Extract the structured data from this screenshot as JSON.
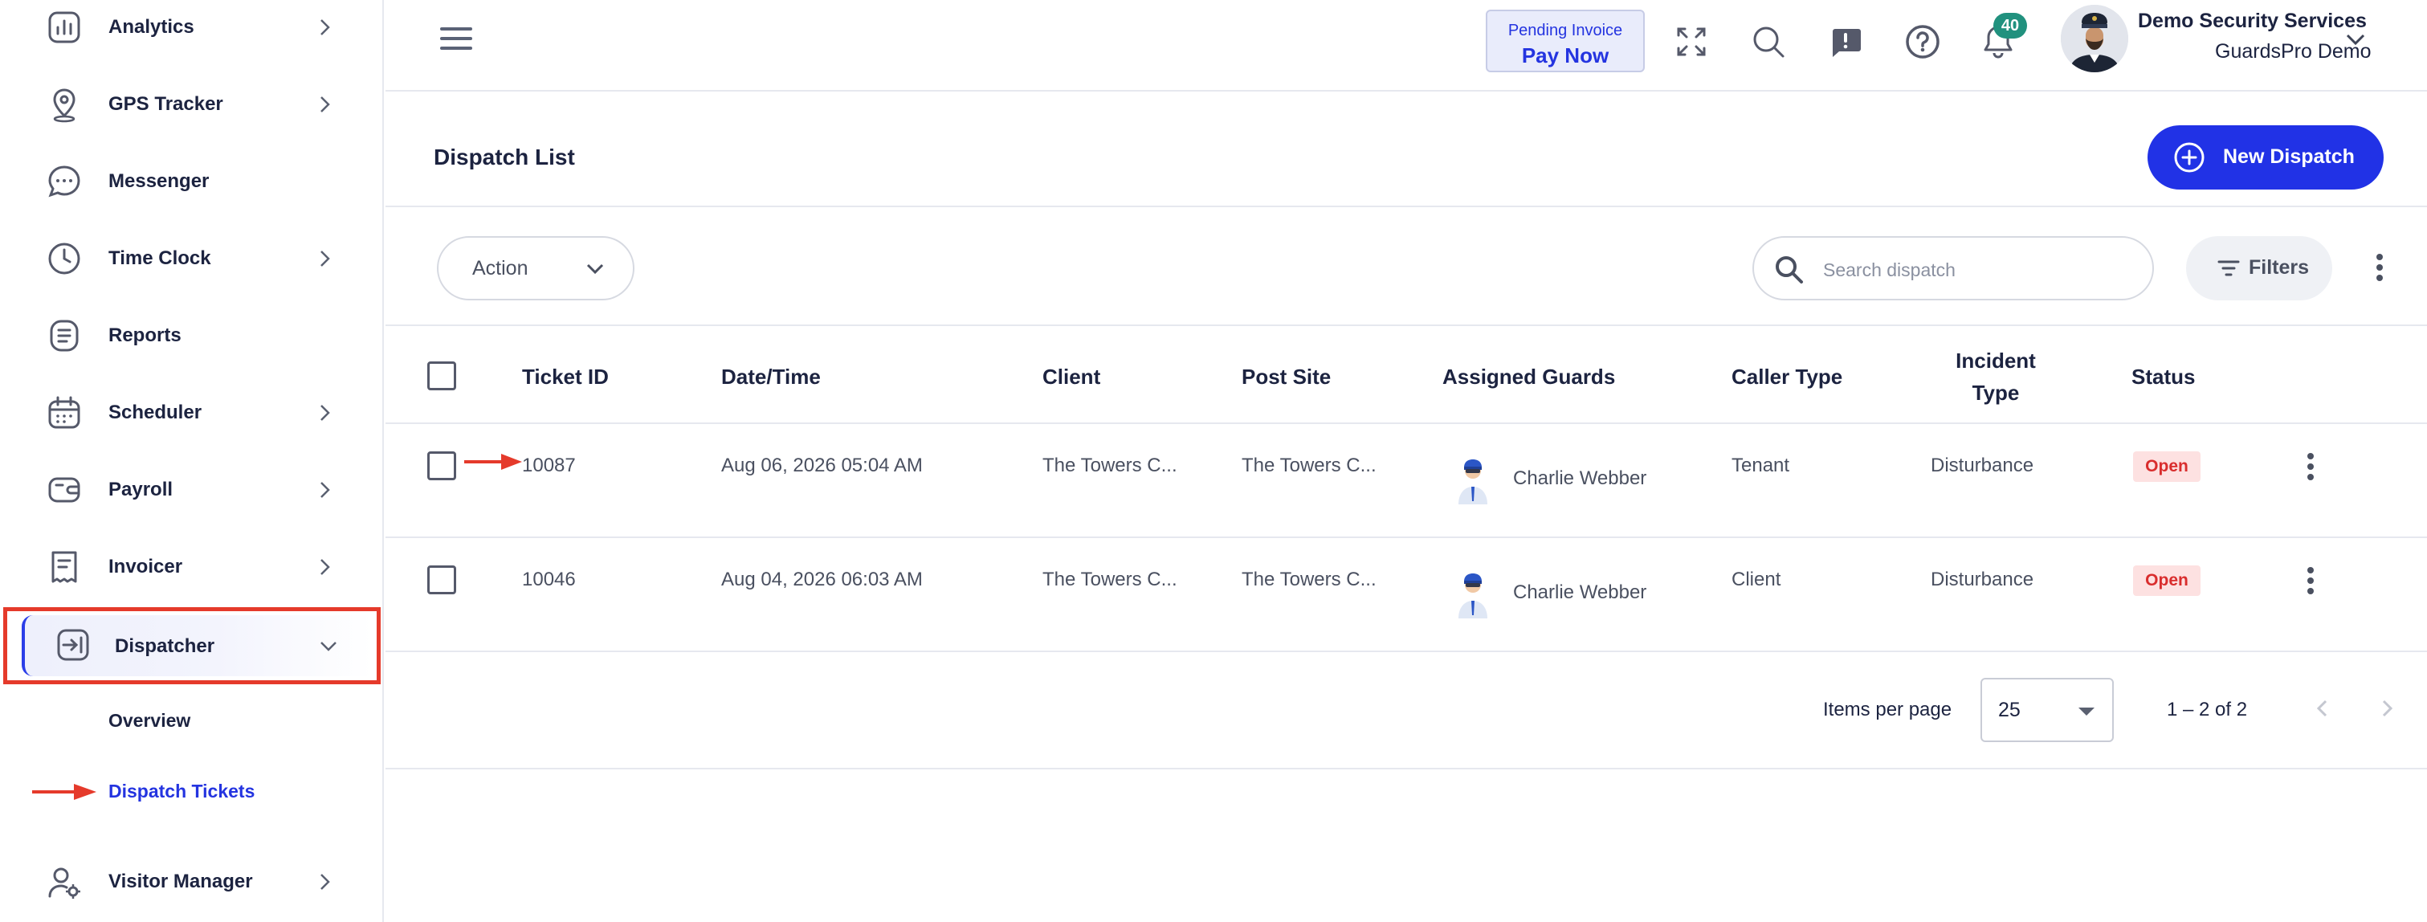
{
  "sidebar": {
    "items": [
      {
        "label": "Analytics",
        "icon": "analytics-icon"
      },
      {
        "label": "GPS Tracker",
        "icon": "location-pin-icon"
      },
      {
        "label": "Messenger",
        "icon": "chat-bubble-icon"
      },
      {
        "label": "Time Clock",
        "icon": "clock-icon"
      },
      {
        "label": "Reports",
        "icon": "report-icon"
      },
      {
        "label": "Scheduler",
        "icon": "calendar-icon"
      },
      {
        "label": "Payroll",
        "icon": "wallet-icon"
      },
      {
        "label": "Invoicer",
        "icon": "invoice-icon"
      },
      {
        "label": "Dispatcher",
        "icon": "dispatch-icon"
      },
      {
        "label": "Visitor Manager",
        "icon": "visitor-icon"
      }
    ],
    "dispatcher_sub": [
      {
        "label": "Overview"
      },
      {
        "label": "Dispatch Tickets"
      }
    ]
  },
  "header": {
    "invoice_line1": "Pending Invoice",
    "invoice_line2": "Pay Now",
    "notification_count": "40",
    "user_name": "Demo Security Services",
    "user_org": "GuardsPro Demo"
  },
  "main": {
    "title": "Dispatch List",
    "new_button": "New Dispatch",
    "action_label": "Action",
    "search_placeholder": "Search dispatch",
    "filters_label": "Filters"
  },
  "table": {
    "headers": {
      "ticket_id": "Ticket ID",
      "datetime": "Date/Time",
      "client": "Client",
      "post_site": "Post Site",
      "guards": "Assigned Guards",
      "caller_type": "Caller Type",
      "incident_line1": "Incident",
      "incident_line2": "Type",
      "status": "Status"
    },
    "rows": [
      {
        "ticket_id": "10087",
        "datetime": "Aug 06, 2026 05:04 AM",
        "client": "The Towers C...",
        "post_site": "The Towers C...",
        "guard": "Charlie Webber",
        "caller_type": "Tenant",
        "incident": "Disturbance",
        "status": "Open"
      },
      {
        "ticket_id": "10046",
        "datetime": "Aug 04, 2026 06:03 AM",
        "client": "The Towers C...",
        "post_site": "The Towers C...",
        "guard": "Charlie Webber",
        "caller_type": "Client",
        "incident": "Disturbance",
        "status": "Open"
      }
    ]
  },
  "pagination": {
    "items_per_page_label": "Items per page",
    "items_per_page": "25",
    "range": "1 – 2 of 2"
  },
  "colors": {
    "accent": "#2132e6",
    "highlight_box": "#e53a2b",
    "status_open_bg": "#fde1e1",
    "status_open_text": "#d92d2d",
    "badge": "#21917e"
  }
}
